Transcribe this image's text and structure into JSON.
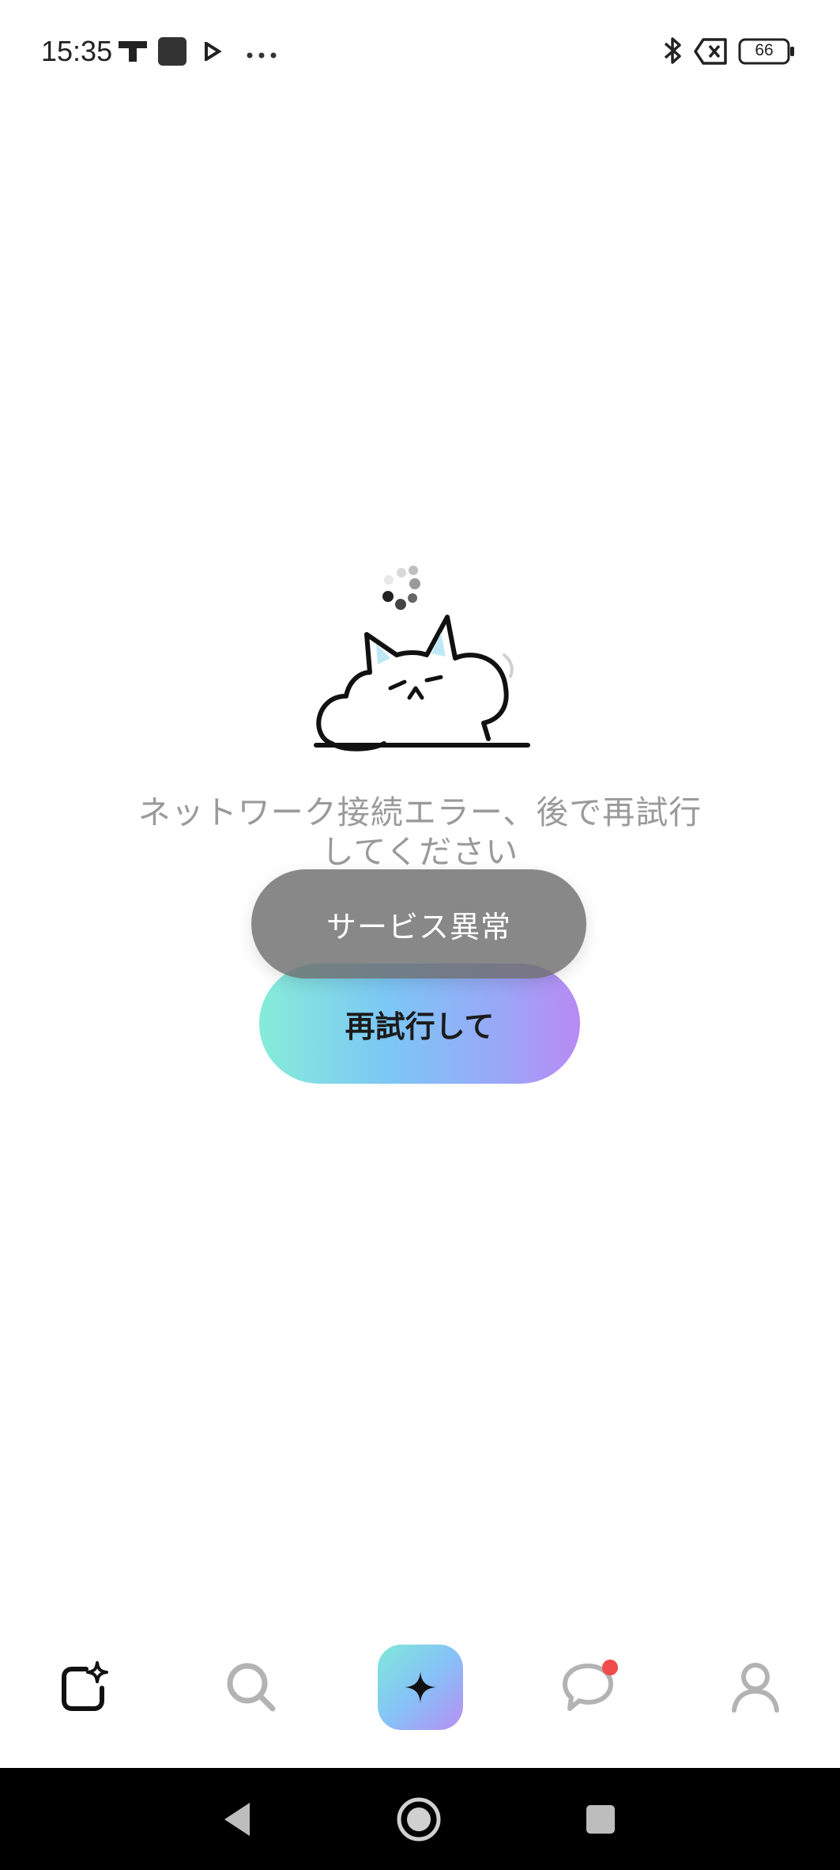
{
  "status_bar": {
    "time": "15:35",
    "battery_level": "66",
    "icons": [
      "tiktok-icon",
      "app-square-icon",
      "play-icon",
      "more-dots-icon",
      "bluetooth-icon",
      "no-sim-icon",
      "battery-icon"
    ]
  },
  "main": {
    "error_message": "ネットワーク接続エラー、後で再試行してください",
    "retry_label": "再試行して",
    "toast_text": "サービス異常"
  },
  "tab_bar": {
    "items": [
      {
        "name": "create",
        "icon": "sparkle-edit-icon"
      },
      {
        "name": "search",
        "icon": "search-icon"
      },
      {
        "name": "ai",
        "icon": "sparkle-icon"
      },
      {
        "name": "messages",
        "icon": "chat-bubble-icon",
        "has_badge": true
      },
      {
        "name": "profile",
        "icon": "user-icon"
      }
    ]
  },
  "colors": {
    "accent_gradient": [
      "#86ecd8",
      "#7cc7f6",
      "#b98af4"
    ],
    "toast_bg": "#6e6e6e",
    "badge": "#f04c4c"
  }
}
